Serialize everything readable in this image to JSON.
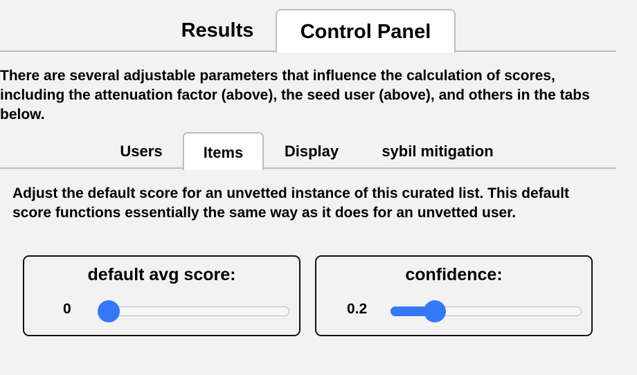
{
  "top_tabs": {
    "results": "Results",
    "control_panel": "Control Panel",
    "active": "Control Panel"
  },
  "intro": "There are several adjustable parameters that influence the calculation of scores, including the attenuation factor (above), the seed user (above), and others in the tabs below.",
  "sub_tabs": {
    "users": "Users",
    "items": "Items",
    "display": "Display",
    "sybil": "sybil mitigation",
    "active": "Items"
  },
  "description": "Adjust the default score for an unvetted instance of this curated list. This default score functions essentially the same way as it does for an unvetted user.",
  "sliders": {
    "avg": {
      "label": "default avg score:",
      "value": "0",
      "fraction": 0.0
    },
    "confidence": {
      "label": "confidence:",
      "value": "0.2",
      "fraction": 0.2
    }
  },
  "colors": {
    "accent": "#3478f6",
    "background": "#f2f2f2",
    "border": "#bdbdbd"
  }
}
